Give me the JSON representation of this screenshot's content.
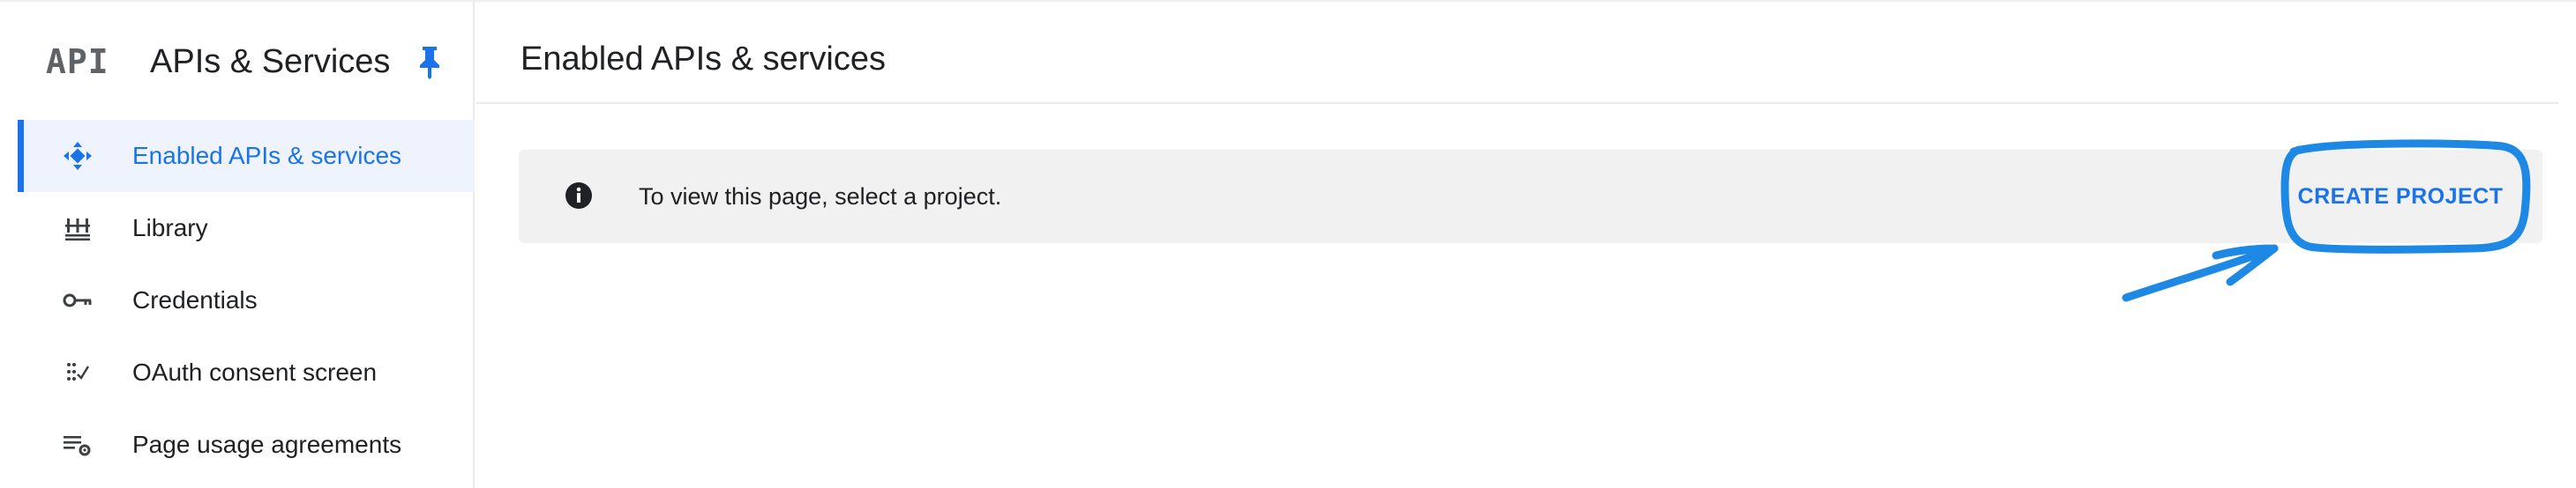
{
  "sidebar": {
    "logo_text": "API",
    "title": "APIs & Services",
    "items": [
      {
        "label": "Enabled APIs & services",
        "icon": "enabled-apis-icon",
        "active": true
      },
      {
        "label": "Library",
        "icon": "library-icon",
        "active": false
      },
      {
        "label": "Credentials",
        "icon": "key-icon",
        "active": false
      },
      {
        "label": "OAuth consent screen",
        "icon": "oauth-consent-icon",
        "active": false
      },
      {
        "label": "Page usage agreements",
        "icon": "settings-list-icon",
        "active": false
      }
    ]
  },
  "main": {
    "title": "Enabled APIs & services",
    "banner": {
      "icon": "info-icon",
      "text": "To view this page, select a project.",
      "action_label": "CREATE PROJECT"
    }
  },
  "colors": {
    "accent": "#1a73e8",
    "active_bg": "#eef3fd",
    "banner_bg": "#f1f1f1",
    "annotation": "#1e88e5"
  }
}
